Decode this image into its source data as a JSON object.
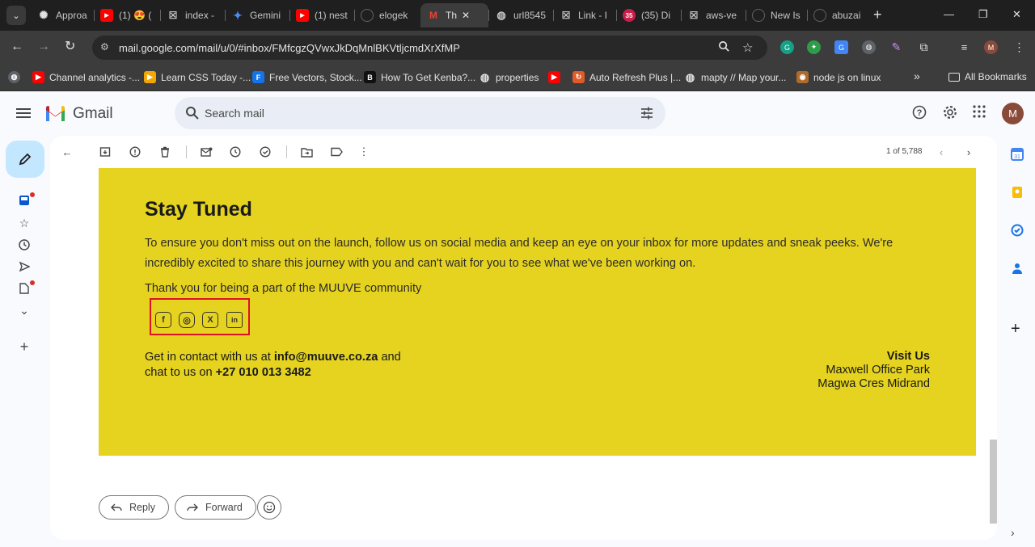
{
  "browser": {
    "tabs": [
      {
        "title": "Approa",
        "icon": "openai-icon",
        "color": "#3c3c3c"
      },
      {
        "title": "(1) 😍 (",
        "icon": "youtube-icon",
        "color": "#ff0000"
      },
      {
        "title": "index -",
        "icon": "x-logo-icon",
        "color": "#3c3c3c"
      },
      {
        "title": "Gemini",
        "icon": "gemini-icon",
        "color": "#4b8bf5"
      },
      {
        "title": "(1) nest",
        "icon": "youtube-icon",
        "color": "#ff0000"
      },
      {
        "title": "elogek",
        "icon": "github-icon",
        "color": "#3c3c3c"
      },
      {
        "title": "Th",
        "icon": "gmail-icon",
        "color": "#ffffff",
        "active": true
      },
      {
        "title": "url8545",
        "icon": "globe-icon",
        "color": "#3c3c3c"
      },
      {
        "title": "Link - I",
        "icon": "x-logo-icon",
        "color": "#3c3c3c"
      },
      {
        "title": "(35) Di",
        "icon": "badge-icon",
        "color": "#c81e4a",
        "badge": "35"
      },
      {
        "title": "aws-ve",
        "icon": "x-logo-icon",
        "color": "#3c3c3c"
      },
      {
        "title": "New Is",
        "icon": "github-icon",
        "color": "#3c3c3c"
      },
      {
        "title": "abuzai",
        "icon": "github-icon",
        "color": "#3c3c3c"
      }
    ],
    "active_tab_close": "✕",
    "new_tab": "+",
    "window_controls": {
      "minimize": "—",
      "maximize": "❐",
      "close": "✕"
    },
    "url": "mail.google.com/mail/u/0/#inbox/FMfcgzQVwxJkDqMnlBKVtljcmdXrXfMP",
    "avatar_letter": "M",
    "bookmarks": [
      {
        "label": "Channel analytics -...",
        "color": "#ff0000",
        "glyph": "▶"
      },
      {
        "label": "Learn CSS Today -...",
        "color": "#f2a600",
        "glyph": "▶"
      },
      {
        "label": "Free Vectors, Stock...",
        "color": "#1273eb",
        "glyph": "F"
      },
      {
        "label": "How To Get Kenba?...",
        "color": "#111111",
        "glyph": "B"
      },
      {
        "label": "properties",
        "color": "#5f6368",
        "glyph": "◍"
      },
      {
        "label": "",
        "color": "#ff0000",
        "glyph": "▶"
      },
      {
        "label": "Auto Refresh Plus |...",
        "color": "#e05a2a",
        "glyph": "↻"
      },
      {
        "label": "mapty // Map your...",
        "color": "#5f6368",
        "glyph": "◍"
      },
      {
        "label": "node js on linux",
        "color": "#b06a2a",
        "glyph": "◉"
      }
    ],
    "bookmarks_more": "»",
    "all_bookmarks": "All Bookmarks"
  },
  "gmail": {
    "wordmark": "Gmail",
    "search_placeholder": "Search mail",
    "avatar_letter": "M",
    "pager": "1 of 5,788"
  },
  "email": {
    "title": "Stay Tuned",
    "paragraph": "To ensure you don't miss out on the launch, follow us on social media and keep an eye on your inbox for more updates and sneak peeks. We're incredibly excited to share this journey with you and can't wait for you to see what we've been working on.",
    "thanks": "Thank you for being a part of the MUUVE community",
    "socials": [
      {
        "name": "facebook",
        "glyph": "f"
      },
      {
        "name": "instagram",
        "glyph": "◎"
      },
      {
        "name": "x",
        "glyph": "X"
      },
      {
        "name": "linkedin",
        "glyph": "in"
      }
    ],
    "contact": {
      "line1_prefix": "Get in contact with us at ",
      "email": "info@muuve.co.za",
      "line1_suffix": " and",
      "line2_prefix": "chat to us on ",
      "phone": "+27 010 013 3482"
    },
    "visit": {
      "heading": "Visit Us",
      "line1": "Maxwell Office Park",
      "line2": "Magwa Cres Midrand"
    },
    "accent_color": "#e5d31f"
  },
  "actions": {
    "reply": "Reply",
    "forward": "Forward"
  }
}
